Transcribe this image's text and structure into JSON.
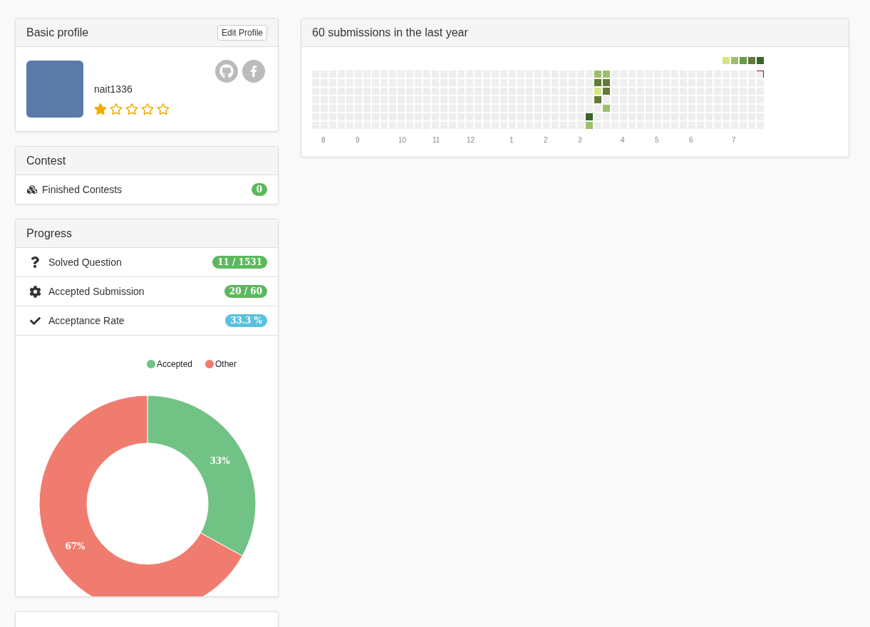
{
  "profile": {
    "title": "Basic profile",
    "edit_button": "Edit Profile",
    "username": "nait1336",
    "stars": 1
  },
  "contest": {
    "title": "Contest",
    "items": [
      {
        "label": "Finished Contests",
        "badge": "0",
        "kind": "success"
      }
    ]
  },
  "progress": {
    "title": "Progress",
    "items": [
      {
        "label": "Solved Question",
        "badge": "11 / 1531",
        "kind": "success"
      },
      {
        "label": "Accepted Submission",
        "badge": "20 / 60",
        "kind": "success"
      },
      {
        "label": "Acceptance Rate",
        "badge": "33.3 %",
        "kind": "info"
      }
    ],
    "chart_data": {
      "type": "donut",
      "categories": [
        "Accepted",
        "Other"
      ],
      "values": [
        33,
        67
      ],
      "value_labels": [
        "33%",
        "67%"
      ],
      "legend": "top"
    }
  },
  "heatmap": {
    "title": "60 submissions in the last year",
    "legend": [
      {
        "color": "#d6e685"
      },
      {
        "color": "#9cc069"
      },
      {
        "color": "#669d45"
      },
      {
        "color": "#637939"
      },
      {
        "color": "#3b6427"
      }
    ],
    "show_today": true,
    "weeks": [
      {
        "days": [
          {
            "color": "#eeeeee"
          },
          {
            "color": "#eeeeee"
          },
          {
            "color": "#eeeeee"
          },
          {
            "color": "#eeeeee"
          },
          {
            "color": "#eeeeee"
          },
          {
            "color": "#eeeeee"
          },
          {
            "color": "#eeeeee"
          }
        ]
      },
      {
        "label": "8",
        "days": [
          {
            "color": "#eeeeee"
          },
          {
            "color": "#eeeeee"
          },
          {
            "color": "#eeeeee"
          },
          {
            "color": "#eeeeee"
          },
          {
            "color": "#eeeeee"
          },
          {
            "color": "#eeeeee"
          },
          {
            "color": "#eeeeee"
          }
        ]
      },
      {
        "days": [
          {
            "color": "#eeeeee"
          },
          {
            "color": "#eeeeee"
          },
          {
            "color": "#eeeeee"
          },
          {
            "color": "#eeeeee"
          },
          {
            "color": "#eeeeee"
          },
          {
            "color": "#eeeeee"
          },
          {
            "color": "#eeeeee"
          }
        ]
      },
      {
        "days": [
          {
            "color": "#eeeeee"
          },
          {
            "color": "#eeeeee"
          },
          {
            "color": "#eeeeee"
          },
          {
            "color": "#eeeeee"
          },
          {
            "color": "#eeeeee"
          },
          {
            "color": "#eeeeee"
          },
          {
            "color": "#eeeeee"
          }
        ]
      },
      {
        "days": [
          {
            "color": "#eeeeee"
          },
          {
            "color": "#eeeeee"
          },
          {
            "color": "#eeeeee"
          },
          {
            "color": "#eeeeee"
          },
          {
            "color": "#eeeeee"
          },
          {
            "color": "#eeeeee"
          },
          {
            "color": "#eeeeee"
          }
        ]
      },
      {
        "label": "9",
        "days": [
          {
            "color": "#eeeeee"
          },
          {
            "color": "#eeeeee"
          },
          {
            "color": "#eeeeee"
          },
          {
            "color": "#eeeeee"
          },
          {
            "color": "#eeeeee"
          },
          {
            "color": "#eeeeee"
          },
          {
            "color": "#eeeeee"
          }
        ]
      },
      {
        "days": [
          {
            "color": "#eeeeee"
          },
          {
            "color": "#eeeeee"
          },
          {
            "color": "#eeeeee"
          },
          {
            "color": "#eeeeee"
          },
          {
            "color": "#eeeeee"
          },
          {
            "color": "#eeeeee"
          },
          {
            "color": "#eeeeee"
          }
        ]
      },
      {
        "days": [
          {
            "color": "#eeeeee"
          },
          {
            "color": "#eeeeee"
          },
          {
            "color": "#eeeeee"
          },
          {
            "color": "#eeeeee"
          },
          {
            "color": "#eeeeee"
          },
          {
            "color": "#eeeeee"
          },
          {
            "color": "#eeeeee"
          }
        ]
      },
      {
        "days": [
          {
            "color": "#eeeeee"
          },
          {
            "color": "#eeeeee"
          },
          {
            "color": "#eeeeee"
          },
          {
            "color": "#eeeeee"
          },
          {
            "color": "#eeeeee"
          },
          {
            "color": "#eeeeee"
          },
          {
            "color": "#eeeeee"
          }
        ]
      },
      {
        "days": [
          {
            "color": "#eeeeee"
          },
          {
            "color": "#eeeeee"
          },
          {
            "color": "#eeeeee"
          },
          {
            "color": "#eeeeee"
          },
          {
            "color": "#eeeeee"
          },
          {
            "color": "#eeeeee"
          },
          {
            "color": "#eeeeee"
          }
        ]
      },
      {
        "label": "10",
        "days": [
          {
            "color": "#eeeeee"
          },
          {
            "color": "#eeeeee"
          },
          {
            "color": "#eeeeee"
          },
          {
            "color": "#eeeeee"
          },
          {
            "color": "#eeeeee"
          },
          {
            "color": "#eeeeee"
          },
          {
            "color": "#eeeeee"
          }
        ]
      },
      {
        "days": [
          {
            "color": "#eeeeee"
          },
          {
            "color": "#eeeeee"
          },
          {
            "color": "#eeeeee"
          },
          {
            "color": "#eeeeee"
          },
          {
            "color": "#eeeeee"
          },
          {
            "color": "#eeeeee"
          },
          {
            "color": "#eeeeee"
          }
        ]
      },
      {
        "days": [
          {
            "color": "#eeeeee"
          },
          {
            "color": "#eeeeee"
          },
          {
            "color": "#eeeeee"
          },
          {
            "color": "#eeeeee"
          },
          {
            "color": "#eeeeee"
          },
          {
            "color": "#eeeeee"
          },
          {
            "color": "#eeeeee"
          }
        ]
      },
      {
        "days": [
          {
            "color": "#eeeeee"
          },
          {
            "color": "#eeeeee"
          },
          {
            "color": "#eeeeee"
          },
          {
            "color": "#eeeeee"
          },
          {
            "color": "#eeeeee"
          },
          {
            "color": "#eeeeee"
          },
          {
            "color": "#eeeeee"
          }
        ]
      },
      {
        "label": "11",
        "days": [
          {
            "color": "#eeeeee"
          },
          {
            "color": "#eeeeee"
          },
          {
            "color": "#eeeeee"
          },
          {
            "color": "#eeeeee"
          },
          {
            "color": "#eeeeee"
          },
          {
            "color": "#eeeeee"
          },
          {
            "color": "#eeeeee"
          }
        ]
      },
      {
        "days": [
          {
            "color": "#eeeeee"
          },
          {
            "color": "#eeeeee"
          },
          {
            "color": "#eeeeee"
          },
          {
            "color": "#eeeeee"
          },
          {
            "color": "#eeeeee"
          },
          {
            "color": "#eeeeee"
          },
          {
            "color": "#eeeeee"
          }
        ]
      },
      {
        "days": [
          {
            "color": "#eeeeee"
          },
          {
            "color": "#eeeeee"
          },
          {
            "color": "#eeeeee"
          },
          {
            "color": "#eeeeee"
          },
          {
            "color": "#eeeeee"
          },
          {
            "color": "#eeeeee"
          },
          {
            "color": "#eeeeee"
          }
        ]
      },
      {
        "days": [
          {
            "color": "#eeeeee"
          },
          {
            "color": "#eeeeee"
          },
          {
            "color": "#eeeeee"
          },
          {
            "color": "#eeeeee"
          },
          {
            "color": "#eeeeee"
          },
          {
            "color": "#eeeeee"
          },
          {
            "color": "#eeeeee"
          }
        ]
      },
      {
        "label": "12",
        "days": [
          {
            "color": "#eeeeee"
          },
          {
            "color": "#eeeeee"
          },
          {
            "color": "#eeeeee"
          },
          {
            "color": "#eeeeee"
          },
          {
            "color": "#eeeeee"
          },
          {
            "color": "#eeeeee"
          },
          {
            "color": "#eeeeee"
          }
        ]
      },
      {
        "days": [
          {
            "color": "#eeeeee"
          },
          {
            "color": "#eeeeee"
          },
          {
            "color": "#eeeeee"
          },
          {
            "color": "#eeeeee"
          },
          {
            "color": "#eeeeee"
          },
          {
            "color": "#eeeeee"
          },
          {
            "color": "#eeeeee"
          }
        ]
      },
      {
        "days": [
          {
            "color": "#eeeeee"
          },
          {
            "color": "#eeeeee"
          },
          {
            "color": "#eeeeee"
          },
          {
            "color": "#eeeeee"
          },
          {
            "color": "#eeeeee"
          },
          {
            "color": "#eeeeee"
          },
          {
            "color": "#eeeeee"
          }
        ]
      },
      {
        "days": [
          {
            "color": "#eeeeee"
          },
          {
            "color": "#eeeeee"
          },
          {
            "color": "#eeeeee"
          },
          {
            "color": "#eeeeee"
          },
          {
            "color": "#eeeeee"
          },
          {
            "color": "#eeeeee"
          },
          {
            "color": "#eeeeee"
          }
        ]
      },
      {
        "days": [
          {
            "color": "#eeeeee"
          },
          {
            "color": "#eeeeee"
          },
          {
            "color": "#eeeeee"
          },
          {
            "color": "#eeeeee"
          },
          {
            "color": "#eeeeee"
          },
          {
            "color": "#eeeeee"
          },
          {
            "color": "#eeeeee"
          }
        ]
      },
      {
        "label": "1",
        "days": [
          {
            "color": "#eeeeee"
          },
          {
            "color": "#eeeeee"
          },
          {
            "color": "#eeeeee"
          },
          {
            "color": "#eeeeee"
          },
          {
            "color": "#eeeeee"
          },
          {
            "color": "#eeeeee"
          },
          {
            "color": "#eeeeee"
          }
        ]
      },
      {
        "days": [
          {
            "color": "#eeeeee"
          },
          {
            "color": "#eeeeee"
          },
          {
            "color": "#eeeeee"
          },
          {
            "color": "#eeeeee"
          },
          {
            "color": "#eeeeee"
          },
          {
            "color": "#eeeeee"
          },
          {
            "color": "#eeeeee"
          }
        ]
      },
      {
        "days": [
          {
            "color": "#eeeeee"
          },
          {
            "color": "#eeeeee"
          },
          {
            "color": "#eeeeee"
          },
          {
            "color": "#eeeeee"
          },
          {
            "color": "#eeeeee"
          },
          {
            "color": "#eeeeee"
          },
          {
            "color": "#eeeeee"
          }
        ]
      },
      {
        "days": [
          {
            "color": "#eeeeee"
          },
          {
            "color": "#eeeeee"
          },
          {
            "color": "#eeeeee"
          },
          {
            "color": "#eeeeee"
          },
          {
            "color": "#eeeeee"
          },
          {
            "color": "#eeeeee"
          },
          {
            "color": "#eeeeee"
          }
        ]
      },
      {
        "label": "2",
        "days": [
          {
            "color": "#eeeeee"
          },
          {
            "color": "#eeeeee"
          },
          {
            "color": "#eeeeee"
          },
          {
            "color": "#eeeeee"
          },
          {
            "color": "#eeeeee"
          },
          {
            "color": "#eeeeee"
          },
          {
            "color": "#eeeeee"
          }
        ]
      },
      {
        "days": [
          {
            "color": "#eeeeee"
          },
          {
            "color": "#eeeeee"
          },
          {
            "color": "#eeeeee"
          },
          {
            "color": "#eeeeee"
          },
          {
            "color": "#eeeeee"
          },
          {
            "color": "#eeeeee"
          },
          {
            "color": "#eeeeee"
          }
        ]
      },
      {
        "days": [
          {
            "color": "#eeeeee"
          },
          {
            "color": "#eeeeee"
          },
          {
            "color": "#eeeeee"
          },
          {
            "color": "#eeeeee"
          },
          {
            "color": "#eeeeee"
          },
          {
            "color": "#eeeeee"
          },
          {
            "color": "#eeeeee"
          }
        ]
      },
      {
        "days": [
          {
            "color": "#eeeeee"
          },
          {
            "color": "#eeeeee"
          },
          {
            "color": "#eeeeee"
          },
          {
            "color": "#eeeeee"
          },
          {
            "color": "#eeeeee"
          },
          {
            "color": "#eeeeee"
          },
          {
            "color": "#eeeeee"
          }
        ]
      },
      {
        "label": "3",
        "days": [
          {
            "color": "#eeeeee"
          },
          {
            "color": "#eeeeee"
          },
          {
            "color": "#eeeeee"
          },
          {
            "color": "#eeeeee"
          },
          {
            "color": "#eeeeee"
          },
          {
            "color": "#eeeeee"
          },
          {
            "color": "#eeeeee"
          }
        ]
      },
      {
        "days": [
          {
            "color": "#eeeeee"
          },
          {
            "color": "#eeeeee"
          },
          {
            "color": "#eeeeee"
          },
          {
            "color": "#eeeeee"
          },
          {
            "color": "#eeeeee"
          },
          {
            "color": "#3b6427"
          },
          {
            "color": "#9cc069"
          }
        ]
      },
      {
        "days": [
          {
            "color": "#9cc069"
          },
          {
            "color": "#637939"
          },
          {
            "color": "#d6e685"
          },
          {
            "color": "#637939"
          },
          {
            "color": "#eeeeee"
          },
          {
            "color": "#eeeeee"
          },
          {
            "color": "#eeeeee"
          }
        ]
      },
      {
        "days": [
          {
            "color": "#9cc069"
          },
          {
            "color": "#637939"
          },
          {
            "color": "#637939"
          },
          {
            "color": "#eeeeee"
          },
          {
            "color": "#9cc069"
          },
          {
            "color": "#eeeeee"
          },
          {
            "color": "#eeeeee"
          }
        ]
      },
      {
        "days": [
          {
            "color": "#eeeeee"
          },
          {
            "color": "#eeeeee"
          },
          {
            "color": "#eeeeee"
          },
          {
            "color": "#eeeeee"
          },
          {
            "color": "#eeeeee"
          },
          {
            "color": "#eeeeee"
          },
          {
            "color": "#eeeeee"
          }
        ]
      },
      {
        "label": "4",
        "days": [
          {
            "color": "#eeeeee"
          },
          {
            "color": "#eeeeee"
          },
          {
            "color": "#eeeeee"
          },
          {
            "color": "#eeeeee"
          },
          {
            "color": "#eeeeee"
          },
          {
            "color": "#eeeeee"
          },
          {
            "color": "#eeeeee"
          }
        ]
      },
      {
        "days": [
          {
            "color": "#eeeeee"
          },
          {
            "color": "#eeeeee"
          },
          {
            "color": "#eeeeee"
          },
          {
            "color": "#eeeeee"
          },
          {
            "color": "#eeeeee"
          },
          {
            "color": "#eeeeee"
          },
          {
            "color": "#eeeeee"
          }
        ]
      },
      {
        "days": [
          {
            "color": "#eeeeee"
          },
          {
            "color": "#eeeeee"
          },
          {
            "color": "#eeeeee"
          },
          {
            "color": "#eeeeee"
          },
          {
            "color": "#eeeeee"
          },
          {
            "color": "#eeeeee"
          },
          {
            "color": "#eeeeee"
          }
        ]
      },
      {
        "days": [
          {
            "color": "#eeeeee"
          },
          {
            "color": "#eeeeee"
          },
          {
            "color": "#eeeeee"
          },
          {
            "color": "#eeeeee"
          },
          {
            "color": "#eeeeee"
          },
          {
            "color": "#eeeeee"
          },
          {
            "color": "#eeeeee"
          }
        ]
      },
      {
        "label": "5",
        "days": [
          {
            "color": "#eeeeee"
          },
          {
            "color": "#eeeeee"
          },
          {
            "color": "#eeeeee"
          },
          {
            "color": "#eeeeee"
          },
          {
            "color": "#eeeeee"
          },
          {
            "color": "#eeeeee"
          },
          {
            "color": "#eeeeee"
          }
        ]
      },
      {
        "days": [
          {
            "color": "#eeeeee"
          },
          {
            "color": "#eeeeee"
          },
          {
            "color": "#eeeeee"
          },
          {
            "color": "#eeeeee"
          },
          {
            "color": "#eeeeee"
          },
          {
            "color": "#eeeeee"
          },
          {
            "color": "#eeeeee"
          }
        ]
      },
      {
        "days": [
          {
            "color": "#eeeeee"
          },
          {
            "color": "#eeeeee"
          },
          {
            "color": "#eeeeee"
          },
          {
            "color": "#eeeeee"
          },
          {
            "color": "#eeeeee"
          },
          {
            "color": "#eeeeee"
          },
          {
            "color": "#eeeeee"
          }
        ]
      },
      {
        "days": [
          {
            "color": "#eeeeee"
          },
          {
            "color": "#eeeeee"
          },
          {
            "color": "#eeeeee"
          },
          {
            "color": "#eeeeee"
          },
          {
            "color": "#eeeeee"
          },
          {
            "color": "#eeeeee"
          },
          {
            "color": "#eeeeee"
          }
        ]
      },
      {
        "label": "6",
        "days": [
          {
            "color": "#eeeeee"
          },
          {
            "color": "#eeeeee"
          },
          {
            "color": "#eeeeee"
          },
          {
            "color": "#eeeeee"
          },
          {
            "color": "#eeeeee"
          },
          {
            "color": "#eeeeee"
          },
          {
            "color": "#eeeeee"
          }
        ]
      },
      {
        "days": [
          {
            "color": "#eeeeee"
          },
          {
            "color": "#eeeeee"
          },
          {
            "color": "#eeeeee"
          },
          {
            "color": "#eeeeee"
          },
          {
            "color": "#eeeeee"
          },
          {
            "color": "#eeeeee"
          },
          {
            "color": "#eeeeee"
          }
        ]
      },
      {
        "days": [
          {
            "color": "#eeeeee"
          },
          {
            "color": "#eeeeee"
          },
          {
            "color": "#eeeeee"
          },
          {
            "color": "#eeeeee"
          },
          {
            "color": "#eeeeee"
          },
          {
            "color": "#eeeeee"
          },
          {
            "color": "#eeeeee"
          }
        ]
      },
      {
        "days": [
          {
            "color": "#eeeeee"
          },
          {
            "color": "#eeeeee"
          },
          {
            "color": "#eeeeee"
          },
          {
            "color": "#eeeeee"
          },
          {
            "color": "#eeeeee"
          },
          {
            "color": "#eeeeee"
          },
          {
            "color": "#eeeeee"
          }
        ]
      },
      {
        "days": [
          {
            "color": "#eeeeee"
          },
          {
            "color": "#eeeeee"
          },
          {
            "color": "#eeeeee"
          },
          {
            "color": "#eeeeee"
          },
          {
            "color": "#eeeeee"
          },
          {
            "color": "#eeeeee"
          },
          {
            "color": "#eeeeee"
          }
        ]
      },
      {
        "label": "7",
        "days": [
          {
            "color": "#eeeeee"
          },
          {
            "color": "#eeeeee"
          },
          {
            "color": "#eeeeee"
          },
          {
            "color": "#eeeeee"
          },
          {
            "color": "#eeeeee"
          },
          {
            "color": "#eeeeee"
          },
          {
            "color": "#eeeeee"
          }
        ]
      },
      {
        "days": [
          {
            "color": "#eeeeee"
          },
          {
            "color": "#eeeeee"
          },
          {
            "color": "#eeeeee"
          },
          {
            "color": "#eeeeee"
          },
          {
            "color": "#eeeeee"
          },
          {
            "color": "#eeeeee"
          },
          {
            "color": "#eeeeee"
          }
        ]
      },
      {
        "days": [
          {
            "color": "#eeeeee"
          },
          {
            "color": "#eeeeee"
          },
          {
            "color": "#eeeeee"
          },
          {
            "color": "#eeeeee"
          },
          {
            "color": "#eeeeee"
          },
          {
            "color": "#eeeeee"
          },
          {
            "color": "#eeeeee"
          }
        ]
      },
      {
        "days": [
          {
            "color": "#eeeeee"
          },
          {
            "color": "#eeeeee"
          },
          {
            "color": "#eeeeee"
          },
          {
            "color": "#eeeeee"
          },
          {
            "color": "#eeeeee"
          },
          {
            "color": "#eeeeee"
          },
          {
            "color": "#eeeeee"
          }
        ]
      }
    ]
  }
}
